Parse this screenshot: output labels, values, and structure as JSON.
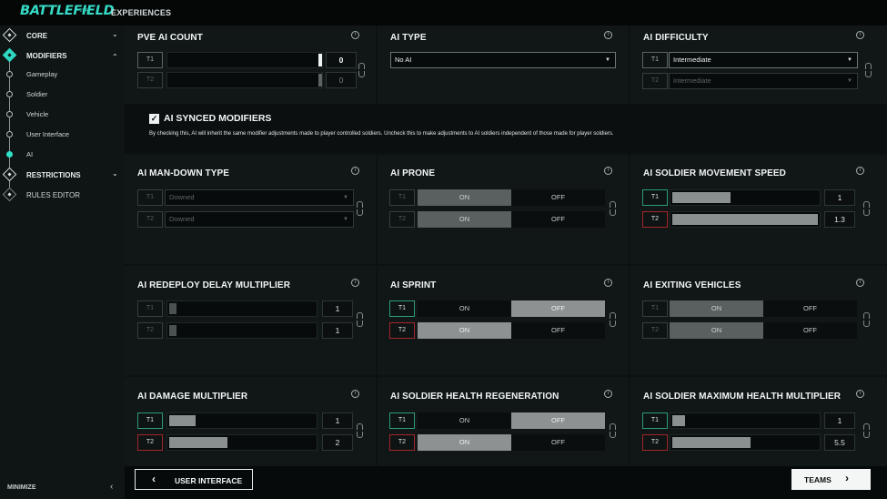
{
  "topbar": {
    "logo": "BATTLEFIELD",
    "logo_sub": "2042",
    "tab": "EXPERIENCES"
  },
  "sidebar": {
    "core": "CORE",
    "modifiers": "MODIFIERS",
    "subitems": [
      "Gameplay",
      "Soldier",
      "Vehicle",
      "User Interface",
      "AI"
    ],
    "restrictions": "RESTRICTIONS",
    "rules_editor": "RULES EDITOR",
    "minimize": "MINIMIZE"
  },
  "team_labels": {
    "t1": "T1",
    "t2": "T2"
  },
  "toggle_labels": {
    "on": "ON",
    "off": "OFF"
  },
  "panels": {
    "pve_ai_count": {
      "title": "PVE AI COUNT",
      "t1": 0,
      "t2": 0
    },
    "ai_type": {
      "title": "AI TYPE",
      "value": "No AI"
    },
    "ai_difficulty": {
      "title": "AI DIFFICULTY",
      "t1": "Intermediate",
      "t2": "Intermediate"
    },
    "ai_synced": {
      "label": "AI SYNCED MODIFIERS",
      "checked": true,
      "description": "By checking this, AI will inherit the same modifier adjustments made to player controlled soldiers. Uncheck this to make adjustments to AI soldiers independent of those made for player soldiers."
    },
    "ai_man_down": {
      "title": "AI MAN-DOWN TYPE",
      "t1": "Downed",
      "t2": "Downed"
    },
    "ai_prone": {
      "title": "AI PRONE",
      "t1": "ON",
      "t2": "ON"
    },
    "ai_move_speed": {
      "title": "AI SOLDIER MOVEMENT SPEED",
      "t1": "1",
      "t2": "1.3",
      "t1_fraction": 0.4,
      "t2_fraction": 1.0
    },
    "ai_redeploy": {
      "title": "AI REDEPLOY DELAY MULTIPLIER",
      "t1": "1",
      "t2": "1",
      "t1_fraction": 0.05,
      "t2_fraction": 0.05
    },
    "ai_sprint": {
      "title": "AI SPRINT",
      "t1": "OFF",
      "t2": "ON"
    },
    "ai_exiting_vehicles": {
      "title": "AI EXITING VEHICLES",
      "t1": "ON",
      "t2": "ON"
    },
    "ai_damage": {
      "title": "AI DAMAGE MULTIPLIER",
      "t1": "1",
      "t2": "2",
      "t1_fraction": 0.18,
      "t2_fraction": 0.4
    },
    "ai_health_regen": {
      "title": "AI SOLDIER HEALTH REGENERATION",
      "t1": "OFF",
      "t2": "ON"
    },
    "ai_max_health": {
      "title": "AI SOLDIER MAXIMUM HEALTH MULTIPLIER",
      "t1": "1",
      "t2": "5.5",
      "t1_fraction": 0.09,
      "t2_fraction": 0.54
    }
  },
  "bottom": {
    "back_label": "USER INTERFACE",
    "next_label": "TEAMS"
  },
  "colors": {
    "accent": "#2fd7c1",
    "team1": "#2c9a7d",
    "team2": "#a3272a"
  }
}
